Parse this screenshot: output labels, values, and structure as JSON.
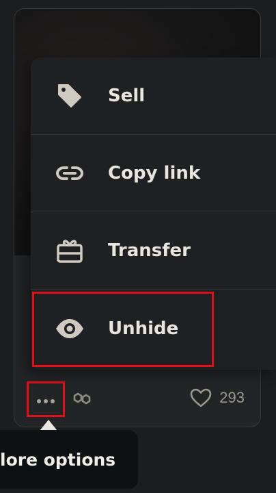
{
  "menu": {
    "items": [
      {
        "label": "Sell",
        "icon": "tag-icon"
      },
      {
        "label": "Copy link",
        "icon": "link-icon"
      },
      {
        "label": "Transfer",
        "icon": "gift-icon"
      },
      {
        "label": "Unhide",
        "icon": "eye-icon"
      }
    ]
  },
  "footer": {
    "more_options_icon": "ellipsis-icon",
    "chain_icon": "polygon-chain-icon",
    "like_icon": "heart-icon",
    "like_count": "293"
  },
  "tooltip": {
    "text": "lore options"
  },
  "colors": {
    "highlight": "#e0101a",
    "menu_bg": "#1f2022",
    "text": "#e9e6df",
    "muted": "#9a978f"
  }
}
